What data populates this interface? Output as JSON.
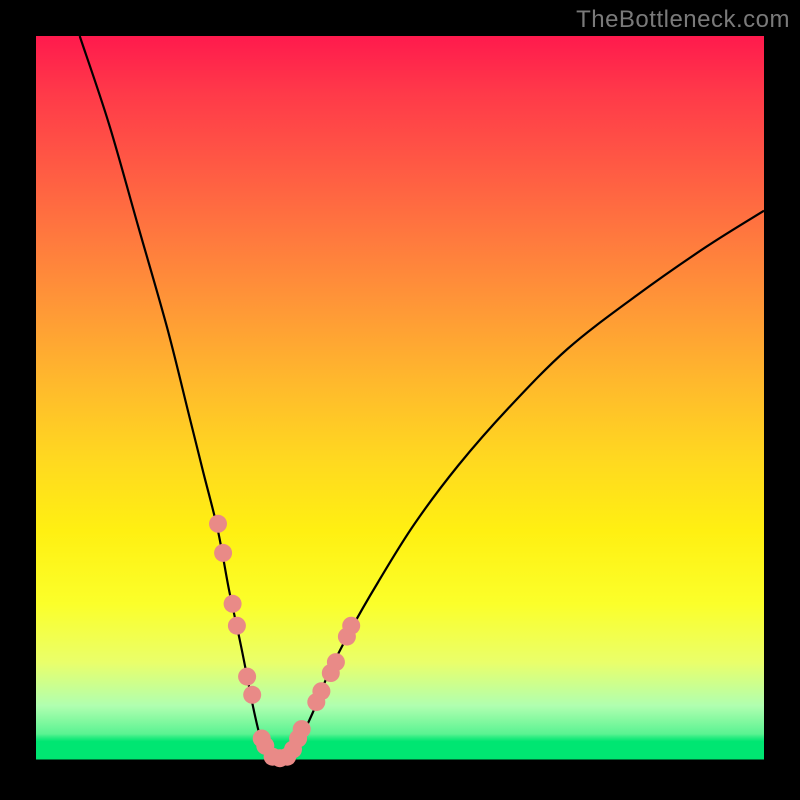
{
  "watermark": "TheBottleneck.com",
  "colors": {
    "curve": "#000000",
    "marker": "#e98a87"
  },
  "chart_data": {
    "type": "line",
    "title": "",
    "xlabel": "",
    "ylabel": "",
    "xlim": [
      0,
      100
    ],
    "ylim": [
      0,
      100
    ],
    "series": [
      {
        "name": "bottleneck-curve",
        "x": [
          6,
          10,
          14,
          18,
          21,
          23,
          25,
          26.5,
          28,
          29,
          30,
          31,
          32,
          33,
          34.5,
          36,
          38,
          40,
          43,
          47,
          52,
          58,
          65,
          73,
          82,
          92,
          100
        ],
        "y": [
          100,
          88,
          74,
          60,
          48,
          40,
          32,
          24,
          17,
          12,
          7,
          3,
          1,
          0.5,
          1,
          3,
          7,
          12,
          18,
          25,
          33,
          41,
          49,
          57,
          64,
          71,
          76
        ]
      }
    ],
    "markers": {
      "name": "data-points",
      "x": [
        25,
        25.7,
        27,
        27.6,
        29,
        29.7,
        31,
        31.5,
        32.5,
        33.5,
        34.5,
        35.3,
        36,
        36.5,
        38.5,
        39.2,
        40.5,
        41.2,
        42.7,
        43.3
      ],
      "y": [
        33,
        29,
        22,
        19,
        12,
        9.5,
        3.5,
        2.5,
        1,
        0.8,
        1,
        2,
        3.5,
        4.8,
        8.5,
        10,
        12.5,
        14,
        17.5,
        19
      ]
    }
  }
}
